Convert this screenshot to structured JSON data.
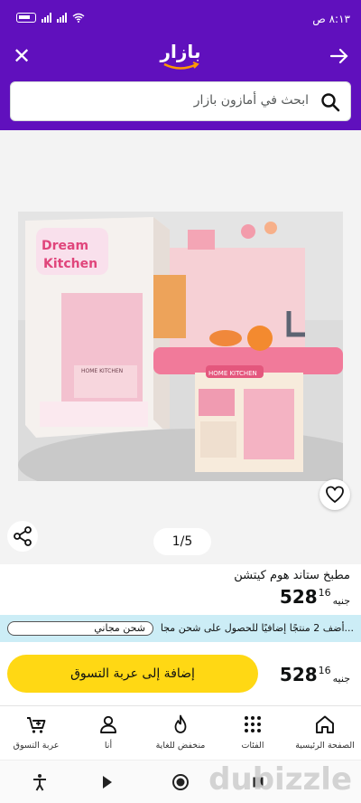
{
  "status_bar": {
    "time": "٨:١٣ ص",
    "battery": "26"
  },
  "header": {
    "logo_text": "بازار"
  },
  "search": {
    "placeholder": "ابحث في أمازون بازار"
  },
  "gallery": {
    "page_indicator": "1/5",
    "image_alt": "Dream Kitchen HOME KITCHEN"
  },
  "product": {
    "title": "مطبخ ستاند هوم كيتشن",
    "price_whole": "528",
    "price_fraction": "16",
    "currency": "جنيه"
  },
  "promo": {
    "message": "أضف 2 منتجًا إضافيًا للحصول على شحن مجا...",
    "progress_label": "شحن مجاني",
    "progress": 0
  },
  "cart_action": {
    "add_label": "إضافة إلى عربة التسوق",
    "price_whole": "528",
    "price_fraction": "16",
    "currency": "جنيه"
  },
  "bottom_nav": {
    "items": [
      {
        "label": "الصفحة الرئيسية",
        "icon": "home-icon"
      },
      {
        "label": "الفئات",
        "icon": "grid-icon"
      },
      {
        "label": "منخفض للغاية",
        "icon": "flame-icon"
      },
      {
        "label": "أنا",
        "icon": "person-icon"
      },
      {
        "label": "عربة التسوق",
        "icon": "cart-icon"
      }
    ]
  },
  "watermark": "dubizzle",
  "colors": {
    "brand": "#6010bd",
    "cta": "#ffd814",
    "promo_bg": "#ccedf6"
  }
}
